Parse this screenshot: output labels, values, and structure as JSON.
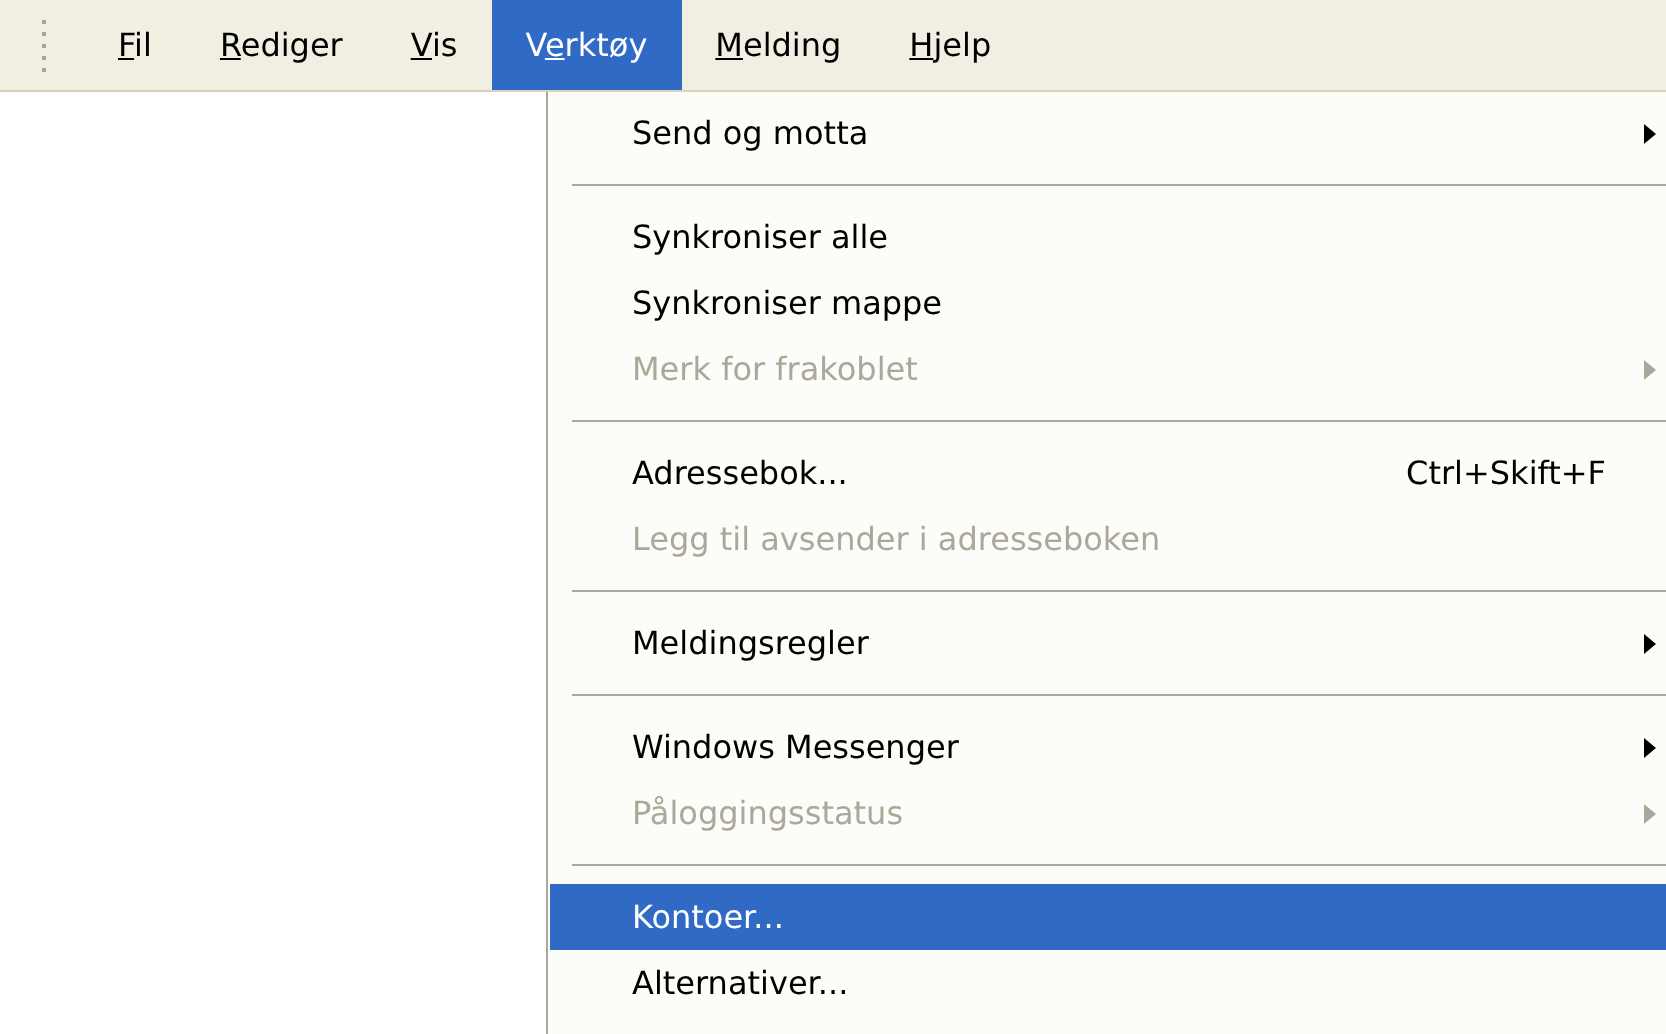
{
  "menubar": {
    "items": [
      {
        "label": {
          "underlined": "F",
          "after": "il"
        },
        "selected": false
      },
      {
        "label": {
          "underlined": "R",
          "after": "ediger"
        },
        "selected": false
      },
      {
        "label": {
          "underlined": "V",
          "after": "is"
        },
        "selected": false
      },
      {
        "label": {
          "before": "V",
          "underlined": "e",
          "after": "rktøy"
        },
        "selected": true
      },
      {
        "label": {
          "underlined": "M",
          "after": "elding"
        },
        "selected": false
      },
      {
        "label": {
          "underlined": "H",
          "after": "jelp"
        },
        "selected": false
      }
    ]
  },
  "menu": {
    "items": [
      {
        "kind": "item",
        "label": "Send og motta",
        "submenu": true,
        "disabled": false,
        "selected": false
      },
      {
        "kind": "separator"
      },
      {
        "kind": "item",
        "label": "Synkroniser alle",
        "submenu": false,
        "disabled": false,
        "selected": false
      },
      {
        "kind": "item",
        "label": "Synkroniser mappe",
        "submenu": false,
        "disabled": false,
        "selected": false
      },
      {
        "kind": "item",
        "label": "Merk for frakoblet",
        "submenu": true,
        "disabled": true,
        "selected": false
      },
      {
        "kind": "separator"
      },
      {
        "kind": "item",
        "label": "Adressebok...",
        "shortcut": "Ctrl+Skift+F",
        "submenu": false,
        "disabled": false,
        "selected": false
      },
      {
        "kind": "item",
        "label": "Legg til avsender i adresseboken",
        "submenu": false,
        "disabled": true,
        "selected": false
      },
      {
        "kind": "separator"
      },
      {
        "kind": "item",
        "label": "Meldingsregler",
        "submenu": true,
        "disabled": false,
        "selected": false
      },
      {
        "kind": "separator"
      },
      {
        "kind": "item",
        "label": "Windows Messenger",
        "submenu": true,
        "disabled": false,
        "selected": false
      },
      {
        "kind": "item",
        "label": "Påloggingsstatus",
        "submenu": true,
        "disabled": true,
        "selected": false
      },
      {
        "kind": "separator"
      },
      {
        "kind": "item",
        "label": "Kontoer...",
        "submenu": false,
        "disabled": false,
        "selected": true
      },
      {
        "kind": "item",
        "label": "Alternativer...",
        "submenu": false,
        "disabled": false,
        "selected": false
      }
    ]
  }
}
